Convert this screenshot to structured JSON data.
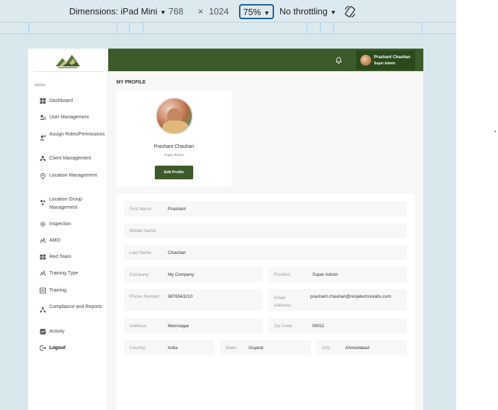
{
  "devtools": {
    "dimensions_label": "Dimensions: iPad Mini",
    "width": "768",
    "times": "×",
    "height": "1024",
    "zoom": "75%",
    "throttling": "No throttling",
    "caret": "▼"
  },
  "sidebar": {
    "menu_title": "MENU",
    "items": [
      {
        "label": "Dashboard",
        "icon": "dashboard-icon"
      },
      {
        "label": "User Management",
        "icon": "users-icon"
      },
      {
        "label": "Assign Roles/Permissions",
        "icon": "roles-icon"
      },
      {
        "label": "Client Management",
        "icon": "client-icon"
      },
      {
        "label": "Location Management",
        "icon": "location-icon"
      },
      {
        "label": "Location Group Management",
        "icon": "location-group-icon"
      },
      {
        "label": "Inspection",
        "icon": "inspection-icon"
      },
      {
        "label": "AMO",
        "icon": "amo-icon"
      },
      {
        "label": "Red Team",
        "icon": "red-team-icon"
      },
      {
        "label": "Training Type",
        "icon": "training-type-icon"
      },
      {
        "label": "Training",
        "icon": "training-icon"
      },
      {
        "label": "Compliance and Reports",
        "icon": "compliance-icon"
      },
      {
        "label": "Activity",
        "icon": "activity-icon"
      },
      {
        "label": "Logout",
        "icon": "logout-icon"
      }
    ]
  },
  "topbar": {
    "user_name": "Prashant Chauhan",
    "user_role": "Super Admin"
  },
  "page": {
    "title": "MY PROFILE"
  },
  "profile_card": {
    "name": "Prashant Chauhan",
    "role": "Super Admin",
    "edit_label": "Edit Profile"
  },
  "details": {
    "first_name": {
      "label": "First Name:",
      "value": "Prashant"
    },
    "middle_name": {
      "label": "Middle Name:",
      "value": ""
    },
    "last_name": {
      "label": "Last Name:",
      "value": "Chauhan"
    },
    "company": {
      "label": "Company:",
      "value": "My Company"
    },
    "position": {
      "label": "Position:",
      "value": "Super Admin"
    },
    "phone": {
      "label": "Phone Number:",
      "value": "9876543210"
    },
    "email": {
      "label": "Email Address:",
      "value": "prashant.chauhan@ninjatechnolabs.com"
    },
    "address": {
      "label": "Address:",
      "value": "Memnagar"
    },
    "zip": {
      "label": "Zip Code:",
      "value": "90011"
    },
    "country": {
      "label": "Country:",
      "value": "India"
    },
    "state": {
      "label": "State:",
      "value": "Gujarat"
    },
    "city": {
      "label": "City:",
      "value": "Ahmedabad"
    }
  },
  "colors": {
    "brand_green": "#3d5a2a",
    "chip_green": "#2a4a1c",
    "devtools_bg": "#dce9ee",
    "zoom_border": "#1a5a8a"
  }
}
